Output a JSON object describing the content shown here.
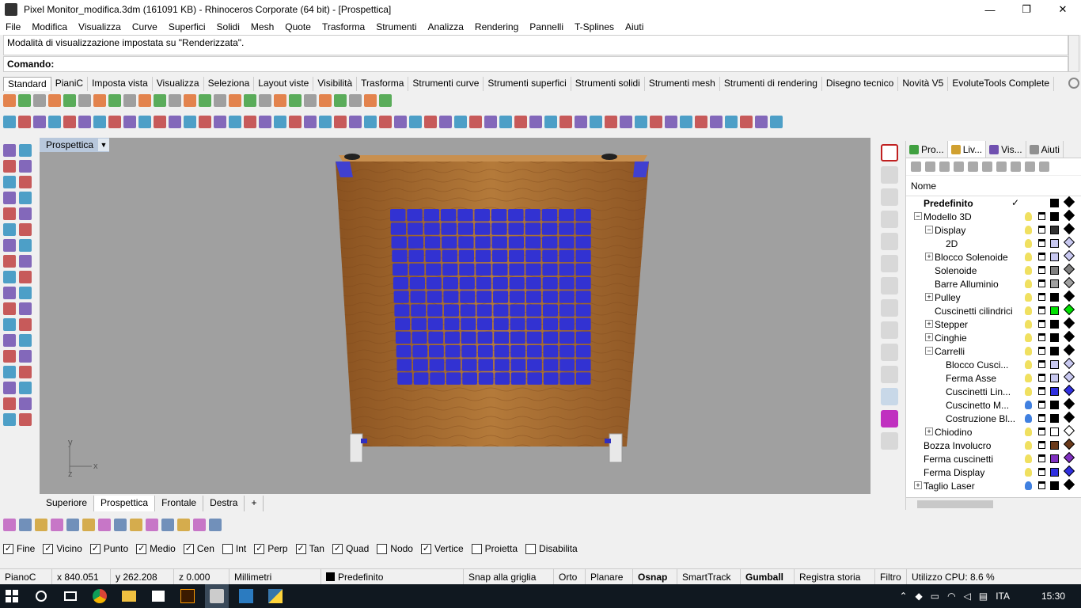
{
  "window": {
    "title": "Pixel Monitor_modifica.3dm (161091 KB) - Rhinoceros Corporate (64 bit) - [Prospettica]",
    "btn_minimize": "—",
    "btn_restore": "❐",
    "btn_close": "✕"
  },
  "menu": [
    "File",
    "Modifica",
    "Visualizza",
    "Curve",
    "Superfici",
    "Solidi",
    "Mesh",
    "Quote",
    "Trasforma",
    "Strumenti",
    "Analizza",
    "Rendering",
    "Pannelli",
    "T-Splines",
    "Aiuti"
  ],
  "command": {
    "history": "Modalità di visualizzazione impostata su \"Renderizzata\".",
    "prompt": "Comando:"
  },
  "toolbar_tabs": [
    "Standard",
    "PianiC",
    "Imposta vista",
    "Visualizza",
    "Seleziona",
    "Layout viste",
    "Visibilità",
    "Trasforma",
    "Strumenti curve",
    "Strumenti superfici",
    "Strumenti solidi",
    "Strumenti mesh",
    "Strumenti di rendering",
    "Disegno tecnico",
    "Novità V5",
    "EvoluteTools Complete"
  ],
  "viewport": {
    "name": "Prospettica",
    "dropdown_glyph": "▼",
    "axis_y": "y",
    "axis_x": "x",
    "axis_z": "z"
  },
  "view_tabs": [
    "Superiore",
    "Prospettica",
    "Frontale",
    "Destra",
    "+"
  ],
  "panel": {
    "tabs": [
      "Pro...",
      "Liv...",
      "Vis...",
      "Aiuti"
    ],
    "column_name": "Nome",
    "layers": [
      {
        "name": "Predefinito",
        "depth": 0,
        "bold": true,
        "current": "✓",
        "toggle": "",
        "bulb": "",
        "color": "#000000",
        "mat": "#000000"
      },
      {
        "name": "Modello 3D",
        "depth": 0,
        "bold": false,
        "current": "",
        "toggle": "−",
        "bulb": "#f0e060",
        "color": "#000000",
        "mat": "#000000"
      },
      {
        "name": "Display",
        "depth": 1,
        "bold": false,
        "current": "",
        "toggle": "−",
        "bulb": "#f0e060",
        "color": "#333333",
        "mat": "#000000"
      },
      {
        "name": "2D",
        "depth": 2,
        "bold": false,
        "current": "",
        "toggle": "",
        "bulb": "#f0e060",
        "color": "#c8c8f0",
        "mat": "#c8c8f0"
      },
      {
        "name": "Blocco Solenoide",
        "depth": 1,
        "bold": false,
        "current": "",
        "toggle": "+",
        "bulb": "#f0e060",
        "color": "#c8c8f0",
        "mat": "#c8c8f0"
      },
      {
        "name": "Solenoide",
        "depth": 1,
        "bold": false,
        "current": "",
        "toggle": "",
        "bulb": "#f0e060",
        "color": "#808080",
        "mat": "#808080"
      },
      {
        "name": "Barre Alluminio",
        "depth": 1,
        "bold": false,
        "current": "",
        "toggle": "",
        "bulb": "#f0e060",
        "color": "#a0a0a0",
        "mat": "#a0a0a0"
      },
      {
        "name": "Pulley",
        "depth": 1,
        "bold": false,
        "current": "",
        "toggle": "+",
        "bulb": "#f0e060",
        "color": "#000000",
        "mat": "#000000"
      },
      {
        "name": "Cuscinetti cilindrici",
        "depth": 1,
        "bold": false,
        "current": "",
        "toggle": "",
        "bulb": "#f0e060",
        "color": "#00e000",
        "mat": "#00e000"
      },
      {
        "name": "Stepper",
        "depth": 1,
        "bold": false,
        "current": "",
        "toggle": "+",
        "bulb": "#f0e060",
        "color": "#000000",
        "mat": "#000000"
      },
      {
        "name": "Cinghie",
        "depth": 1,
        "bold": false,
        "current": "",
        "toggle": "+",
        "bulb": "#f0e060",
        "color": "#000000",
        "mat": "#000000"
      },
      {
        "name": "Carrelli",
        "depth": 1,
        "bold": false,
        "current": "",
        "toggle": "−",
        "bulb": "#f0e060",
        "color": "#000000",
        "mat": "#000000"
      },
      {
        "name": "Blocco Cusci...",
        "depth": 2,
        "bold": false,
        "current": "",
        "toggle": "",
        "bulb": "#f0e060",
        "color": "#c8c8f0",
        "mat": "#c8c8f0"
      },
      {
        "name": "Ferma Asse",
        "depth": 2,
        "bold": false,
        "current": "",
        "toggle": "",
        "bulb": "#f0e060",
        "color": "#c8c8f0",
        "mat": "#c8c8f0"
      },
      {
        "name": "Cuscinetti Lin...",
        "depth": 2,
        "bold": false,
        "current": "",
        "toggle": "",
        "bulb": "#f0e060",
        "color": "#3030e0",
        "mat": "#3030e0"
      },
      {
        "name": "Cuscinetto M...",
        "depth": 2,
        "bold": false,
        "current": "",
        "toggle": "",
        "bulb": "#4080e0",
        "color": "#000000",
        "mat": "#000000"
      },
      {
        "name": "Costruzione Bl...",
        "depth": 2,
        "bold": false,
        "current": "",
        "toggle": "",
        "bulb": "#4080e0",
        "color": "#000000",
        "mat": "#000000"
      },
      {
        "name": "Chiodino",
        "depth": 1,
        "bold": false,
        "current": "",
        "toggle": "+",
        "bulb": "#f0e060",
        "color": "#ffffff",
        "mat": "#ffffff"
      },
      {
        "name": "Bozza Involucro",
        "depth": 0,
        "bold": false,
        "current": "",
        "toggle": "",
        "bulb": "#f0e060",
        "color": "#6b3a1a",
        "mat": "#6b3a1a"
      },
      {
        "name": "Ferma cuscinetti",
        "depth": 0,
        "bold": false,
        "current": "",
        "toggle": "",
        "bulb": "#f0e060",
        "color": "#8030c0",
        "mat": "#8030c0"
      },
      {
        "name": "Ferma Display",
        "depth": 0,
        "bold": false,
        "current": "",
        "toggle": "",
        "bulb": "#f0e060",
        "color": "#3030e0",
        "mat": "#3030e0"
      },
      {
        "name": "Taglio Laser",
        "depth": 0,
        "bold": false,
        "current": "",
        "toggle": "+",
        "bulb": "#4080e0",
        "color": "#000000",
        "mat": "#000000"
      }
    ]
  },
  "osnap": [
    {
      "label": "Fine",
      "checked": true
    },
    {
      "label": "Vicino",
      "checked": true
    },
    {
      "label": "Punto",
      "checked": true
    },
    {
      "label": "Medio",
      "checked": true
    },
    {
      "label": "Cen",
      "checked": true
    },
    {
      "label": "Int",
      "checked": false
    },
    {
      "label": "Perp",
      "checked": true
    },
    {
      "label": "Tan",
      "checked": true
    },
    {
      "label": "Quad",
      "checked": true
    },
    {
      "label": "Nodo",
      "checked": false
    },
    {
      "label": "Vertice",
      "checked": true
    },
    {
      "label": "Proietta",
      "checked": false
    },
    {
      "label": "Disabilita",
      "checked": false
    }
  ],
  "status": {
    "plane": "PianoC",
    "x": "x 840.051",
    "y": "y 262.208",
    "z": "z 0.000",
    "units": "Millimetri",
    "layer": "Predefinito",
    "snap_grid": "Snap alla griglia",
    "orto": "Orto",
    "planare": "Planare",
    "osnap": "Osnap",
    "smarttrack": "SmartTrack",
    "gumball": "Gumball",
    "history": "Registra storia",
    "filter": "Filtro",
    "cpu": "Utilizzo CPU: 8.6 %"
  },
  "taskbar": {
    "lang": "ITA",
    "time": "15:30"
  },
  "colors": {
    "wood": "#a0652a",
    "pixel": "#3232d2",
    "viewport_bg": "#a0a0a0",
    "active_view_label": "#b8c8dc"
  },
  "icons": {
    "toolbar_row1": [
      "new-icon",
      "open-icon",
      "save-icon",
      "print-icon",
      "import-icon",
      "cut-icon",
      "copy-icon",
      "paste-icon",
      "undo-icon",
      "pan-icon",
      "rotate-view-icon",
      "zoom-icon",
      "zoom-window-icon",
      "zoom-extents-icon",
      "zoom-selected-icon",
      "four-views-icon",
      "grid-icon",
      "render-icon",
      "light-icon",
      "lock-icon",
      "material-icon",
      "sphere-icon",
      "shaded-icon",
      "render-preview-icon",
      "help-icon",
      "options-icon"
    ]
  }
}
